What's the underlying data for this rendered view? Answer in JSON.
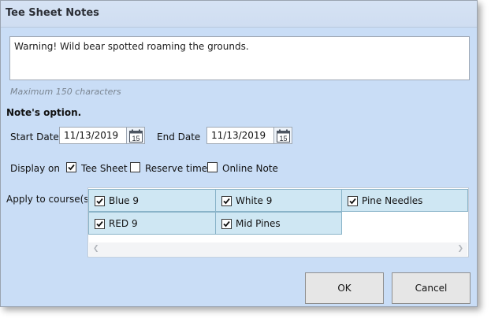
{
  "dialog": {
    "title": "Tee Sheet Notes",
    "note_text": "Warning! Wild bear spotted roaming the grounds.",
    "max_chars_hint": "Maximum 150 characters",
    "option_heading": "Note's option.",
    "start_date_label": "Start Date",
    "start_date_value": "11/13/2019",
    "end_date_label": "End Date",
    "end_date_value": "11/13/2019",
    "calendar_day": "15",
    "display_on_label": "Display on",
    "display_options": [
      {
        "label": "Tee Sheet",
        "checked": true
      },
      {
        "label": "Reserve time",
        "checked": false
      },
      {
        "label": "Online Note",
        "checked": false
      }
    ],
    "apply_label": "Apply to course(s):",
    "courses": [
      {
        "label": "Blue 9",
        "checked": true
      },
      {
        "label": "White 9",
        "checked": true
      },
      {
        "label": "Pine Needles",
        "checked": true
      },
      {
        "label": "RED 9",
        "checked": true
      },
      {
        "label": "Mid Pines",
        "checked": true
      }
    ],
    "ok_label": "OK",
    "cancel_label": "Cancel"
  },
  "icons": {
    "calendar": "calendar-icon",
    "checkmark": "checkmark-icon",
    "scroll_left": "chevron-left-icon",
    "scroll_right": "chevron-right-icon"
  }
}
